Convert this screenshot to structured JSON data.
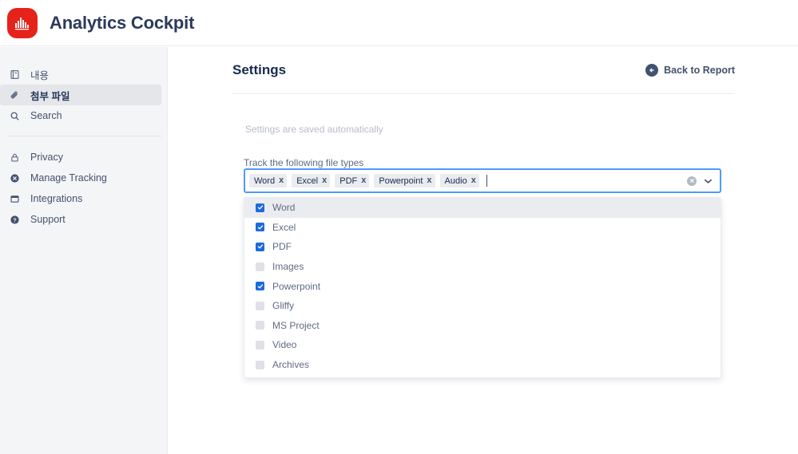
{
  "header": {
    "app_title": "Analytics Cockpit",
    "logo_icon": "bar-chart-logo-icon",
    "logo_color": "#e5231b"
  },
  "sidebar": {
    "groups": [
      {
        "items": [
          {
            "label": "내용",
            "icon": "book-icon",
            "active": false
          },
          {
            "label": "첨부 파일",
            "icon": "paperclip-icon",
            "active": true
          },
          {
            "label": "Search",
            "icon": "search-icon",
            "active": false
          }
        ]
      },
      {
        "items": [
          {
            "label": "Privacy",
            "icon": "lock-icon",
            "active": false
          },
          {
            "label": "Manage Tracking",
            "icon": "x-circle-icon",
            "active": false
          },
          {
            "label": "Integrations",
            "icon": "window-icon",
            "active": false
          },
          {
            "label": "Support",
            "icon": "question-circle-icon",
            "active": false
          }
        ]
      }
    ]
  },
  "main": {
    "page_title": "Settings",
    "back_link": {
      "label": "Back to Report",
      "icon": "arrow-left-circle-icon"
    },
    "autosave_note": "Settings are saved automatically",
    "field": {
      "label": "Track the following file types",
      "clear_icon": "clear-circle-icon",
      "chevron_icon": "chevron-down-icon",
      "remove_icon": "x",
      "tags": [
        "Word",
        "Excel",
        "PDF",
        "Powerpoint",
        "Audio"
      ],
      "options": [
        {
          "label": "Word",
          "checked": true,
          "highlighted": true
        },
        {
          "label": "Excel",
          "checked": true,
          "highlighted": false
        },
        {
          "label": "PDF",
          "checked": true,
          "highlighted": false
        },
        {
          "label": "Images",
          "checked": false,
          "highlighted": false
        },
        {
          "label": "Powerpoint",
          "checked": true,
          "highlighted": false
        },
        {
          "label": "Gliffy",
          "checked": false,
          "highlighted": false
        },
        {
          "label": "MS Project",
          "checked": false,
          "highlighted": false
        },
        {
          "label": "Video",
          "checked": false,
          "highlighted": false
        },
        {
          "label": "Archives",
          "checked": false,
          "highlighted": false
        }
      ]
    }
  },
  "colors": {
    "accent_blue": "#4c9aff",
    "checkbox_blue": "#1a6ae0",
    "brand_red": "#e5231b",
    "text_navy": "#172b4d",
    "sidebar_bg": "#f4f5f7"
  }
}
